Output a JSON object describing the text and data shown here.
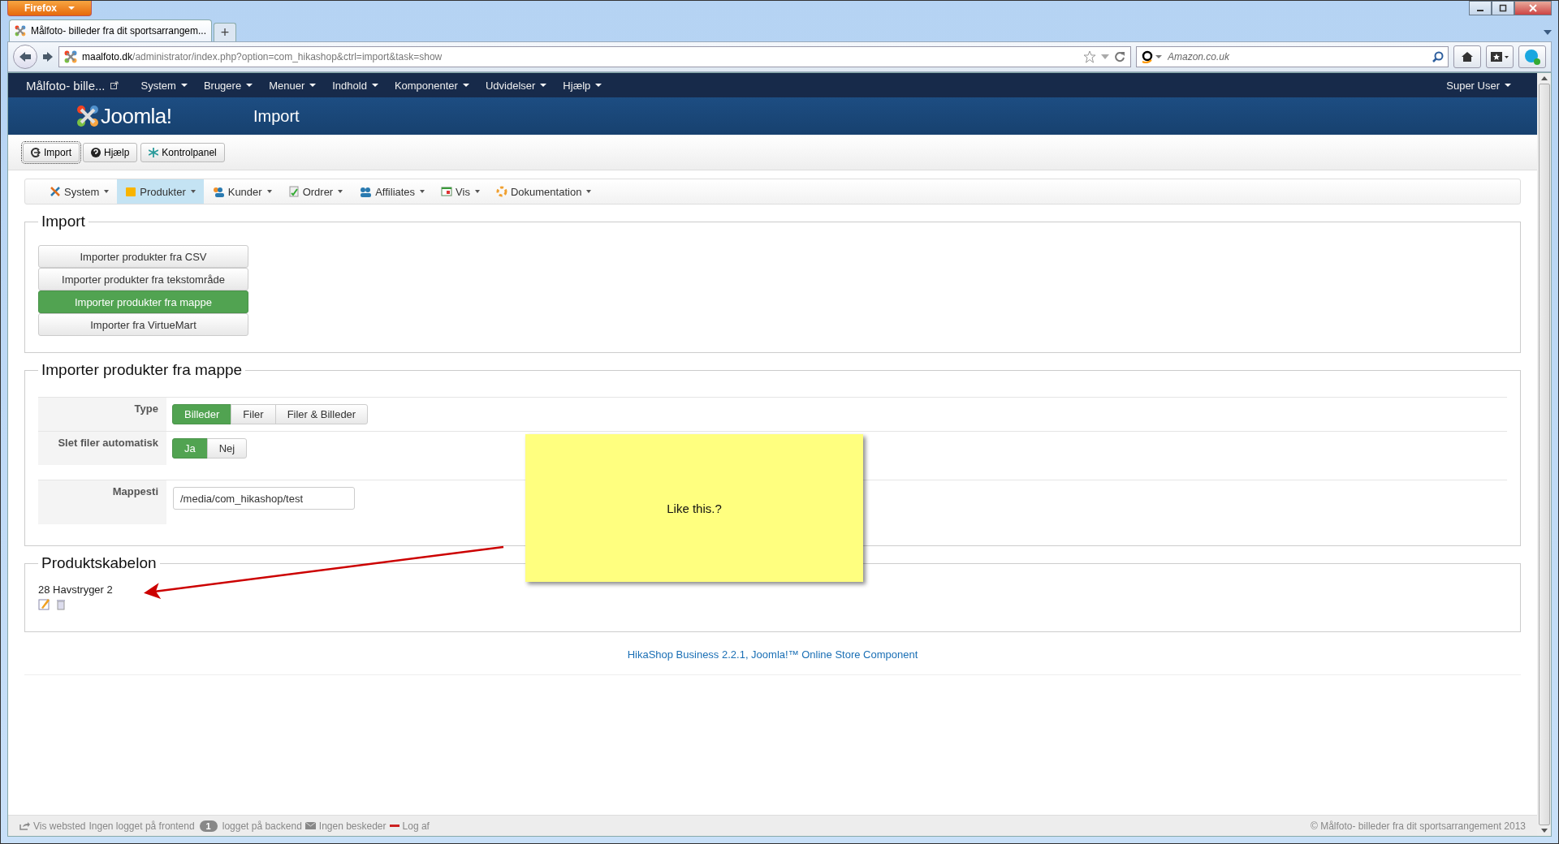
{
  "browser": {
    "menu_button": "Firefox",
    "tab_title": "Målfoto- billeder fra dit sportsarrangem...",
    "new_tab": "+",
    "url_domain": "maalfoto.dk",
    "url_path": "/administrator/index.php?option=com_hikashop&ctrl=import&task=show",
    "search_placeholder": "Amazon.co.uk"
  },
  "admin_menu": {
    "site": "Målfoto- bille...",
    "items": [
      "System",
      "Brugere",
      "Menuer",
      "Indhold",
      "Komponenter",
      "Udvidelser",
      "Hjælp"
    ],
    "user": "Super User"
  },
  "header": {
    "logo_text": "Joomla!",
    "title": "Import"
  },
  "toolbar": [
    {
      "label": "Import",
      "kind": "import",
      "focused": true
    },
    {
      "label": "Hjælp",
      "kind": "help",
      "focused": false
    },
    {
      "label": "Kontrolpanel",
      "kind": "panel",
      "focused": false
    }
  ],
  "submenu": [
    {
      "label": "System",
      "kind": "tools",
      "selected": false
    },
    {
      "label": "Produkter",
      "kind": "folder",
      "selected": true
    },
    {
      "label": "Kunder",
      "kind": "user",
      "selected": false
    },
    {
      "label": "Ordrer",
      "kind": "doc",
      "selected": false
    },
    {
      "label": "Affiliates",
      "kind": "users",
      "selected": false
    },
    {
      "label": "Vis",
      "kind": "window",
      "selected": false
    },
    {
      "label": "Dokumentation",
      "kind": "help",
      "selected": false
    }
  ],
  "import": {
    "title": "Import",
    "options": [
      {
        "label": "Importer produkter fra CSV",
        "selected": false
      },
      {
        "label": "Importer produkter fra tekstområde",
        "selected": false
      },
      {
        "label": "Importer produkter fra mappe",
        "selected": true
      },
      {
        "label": "Importer fra VirtueMart",
        "selected": false
      }
    ]
  },
  "folder_import": {
    "title": "Importer produkter fra mappe",
    "fields": [
      {
        "label": "Type",
        "kind": "toggle",
        "options": [
          {
            "label": "Billeder",
            "selected": true
          },
          {
            "label": "Filer",
            "selected": false
          },
          {
            "label": "Filer & Billeder",
            "selected": false
          }
        ]
      },
      {
        "label": "Slet filer automatisk",
        "kind": "toggle",
        "options": [
          {
            "label": "Ja",
            "selected": true
          },
          {
            "label": "Nej",
            "selected": false
          }
        ]
      },
      {
        "label": "Mappesti",
        "kind": "text",
        "value": "/media/com_hikashop/test"
      }
    ]
  },
  "template": {
    "title": "Produktskabelon",
    "product": "28 Havstryger 2"
  },
  "footer_link": "HikaShop Business 2.2.1, Joomla!™ Online Store Component",
  "note": {
    "text": "Like this.?"
  },
  "status_bar": {
    "view_site": "Vis websted",
    "frontend": "Ingen logget på frontend",
    "backend_count": "1",
    "backend": "logget på backend",
    "messages": "Ingen beskeder",
    "logout": "Log af",
    "copyright": "© Målfoto- billeder fra dit sportsarrangement 2013"
  }
}
